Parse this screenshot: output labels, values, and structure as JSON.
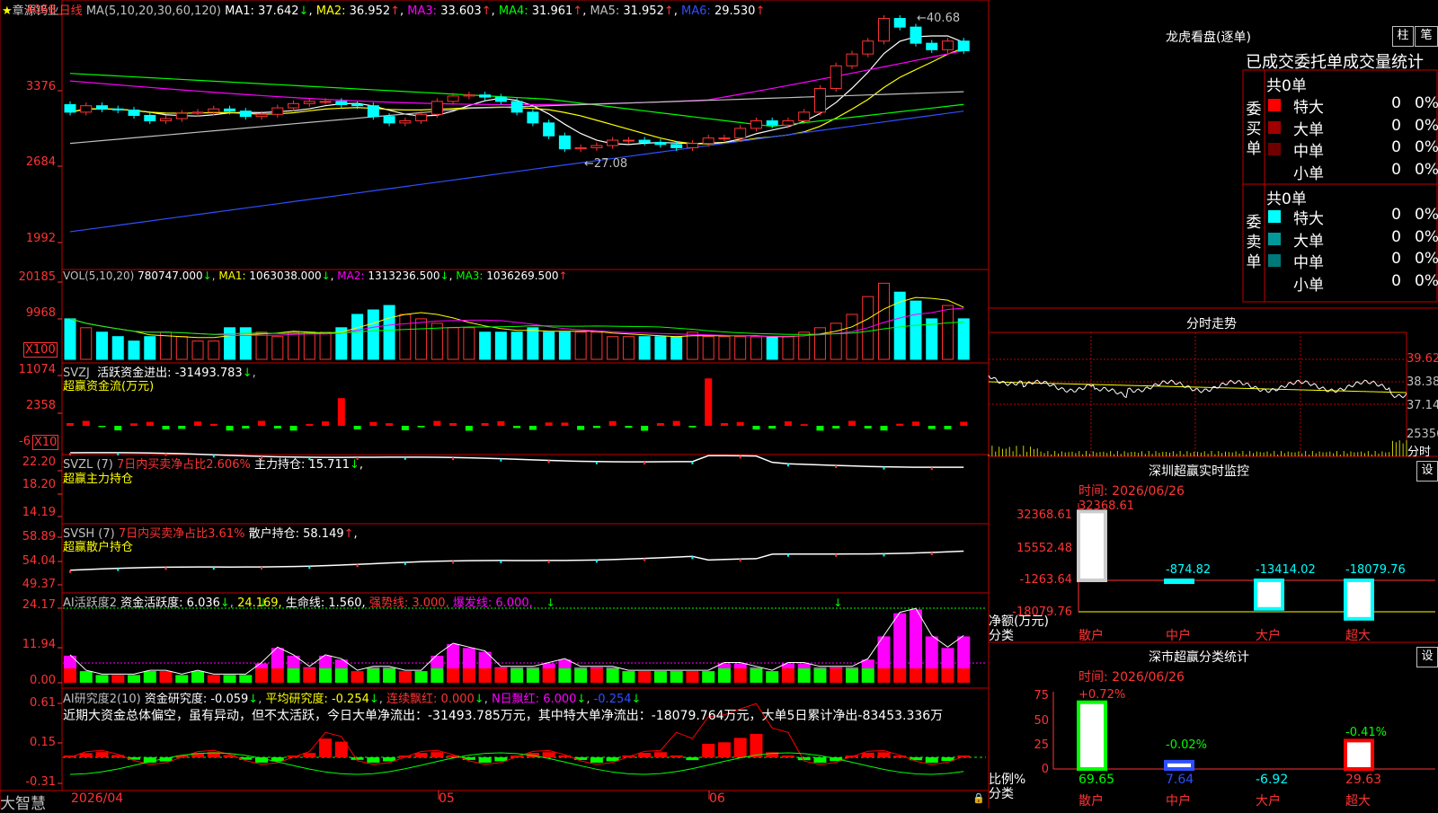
{
  "stock": {
    "name": "章源钨业",
    "period": "日线",
    "brand": "大智慧"
  },
  "kline": {
    "ma_header": "MA(5,10,20,30,60,120)",
    "ma": [
      {
        "label": "MA1:",
        "value": "37.642",
        "arrow": "↓",
        "color": "#ffffff"
      },
      {
        "label": "MA2:",
        "value": "36.952",
        "arrow": "↑",
        "color": "#ffff00"
      },
      {
        "label": "MA3:",
        "value": "33.603",
        "arrow": "↑",
        "color": "#ff00ff"
      },
      {
        "label": "MA4:",
        "value": "31.961",
        "arrow": "↑",
        "color": "#00ff00"
      },
      {
        "label": "MA5:",
        "value": "31.952",
        "arrow": "↑",
        "color": "#c0c0c0"
      },
      {
        "label": "MA6:",
        "value": "29.530",
        "arrow": "↑",
        "color": "#2f4fff"
      }
    ],
    "y_ticks": [
      "4068",
      "3376",
      "2684",
      "1992"
    ],
    "high_mark": "←40.68",
    "low_mark": "←27.08"
  },
  "volume": {
    "header": "VOL(5,10,20)",
    "value": "780747.000",
    "arrow": "↓",
    "ma": [
      {
        "label": "MA1:",
        "value": "1063038.000",
        "arrow": "↓",
        "color": "#ffff00"
      },
      {
        "label": "MA2:",
        "value": "1313236.500",
        "arrow": "↓",
        "color": "#ff00ff"
      },
      {
        "label": "MA3:",
        "value": "1036269.500",
        "arrow": "↑",
        "color": "#00ff00"
      }
    ],
    "y_ticks": [
      "20185",
      "9968"
    ],
    "unit": "X100"
  },
  "svzj": {
    "name": "SVZJ",
    "label": "活跃资金进出:",
    "value": "-31493.783",
    "arrow": "↓",
    "subtitle": "超赢资金流(万元)",
    "y_ticks": [
      "11074",
      "2358",
      "-6"
    ],
    "unit": "X10"
  },
  "svzl": {
    "name": "SVZL (7)",
    "note": "7日内买卖净占比2.606%",
    "label": "主力持仓:",
    "value": "15.711",
    "arrow": "↓",
    "trail": ",",
    "subtitle": "超赢主力持仓",
    "y_ticks": [
      "22.20",
      "18.20",
      "14.19"
    ]
  },
  "svsh": {
    "name": "SVSH (7)",
    "note": "7日内买卖净占比3.61%",
    "label": "散户持仓:",
    "value": "58.149",
    "arrow": "↑",
    "trail": ",",
    "subtitle": "超赢散户持仓",
    "y_ticks": [
      "58.89",
      "54.04",
      "49.37"
    ]
  },
  "ai_active": {
    "name": "AI活跃度2",
    "label": "资金活跃度:",
    "value": "6.036",
    "arrow": "↓",
    "v2": "24.169,",
    "life": "生命线: 1.560,",
    "strong": "强势线: 3.000,",
    "burst": "爆发线: 6.000,",
    "y_ticks": [
      "24.17",
      "11.94",
      "0.00"
    ]
  },
  "ai_research": {
    "name": "AI研究度2(10)",
    "label": "资金研究度:",
    "value": "-0.059",
    "arrow": "↓",
    "avg": "平均研究度: -0.254",
    "avg_arrow": "↓",
    "cont": "连续飘红: 0.000",
    "cont_arrow": "↓",
    "nday": "N日飘红: 6.000",
    "nday_arrow": "↓",
    "last": "-0.254",
    "last_arrow": "↓",
    "summary": "近期大资金总体偏空，虽有异动，但不太活跃，今日大单净流出：-31493.785万元，其中特大单净流出：-18079.764万元，大单5日累计净出-83453.336万",
    "y_ticks": [
      "0.61",
      "0.15",
      "-0.31"
    ]
  },
  "x_axis": {
    "labels": [
      "2026/04",
      "05",
      "06"
    ]
  },
  "longhu": {
    "title": "龙虎看盘(逐单)",
    "btn1": "柱",
    "btn2": "笔",
    "subtitle": "已成交委托单成交量统计",
    "buy": {
      "side": "委买单",
      "total": "共0单",
      "rows": [
        {
          "name": "特大",
          "val": "0",
          "pct": "0%",
          "color": "#ff0000"
        },
        {
          "name": "大单",
          "val": "0",
          "pct": "0%",
          "color": "#a00000"
        },
        {
          "name": "中单",
          "val": "0",
          "pct": "0%",
          "color": "#700000"
        },
        {
          "name": "小单",
          "val": "0",
          "pct": "0%",
          "color": "#000000"
        }
      ]
    },
    "sell": {
      "side": "委卖单",
      "total": "共0单",
      "rows": [
        {
          "name": "特大",
          "val": "0",
          "pct": "0%",
          "color": "#00ffff"
        },
        {
          "name": "大单",
          "val": "0",
          "pct": "0%",
          "color": "#009a9a"
        },
        {
          "name": "中单",
          "val": "0",
          "pct": "0%",
          "color": "#007878"
        },
        {
          "name": "小单",
          "val": "0",
          "pct": "0%",
          "color": "#000000"
        }
      ]
    }
  },
  "fenshi": {
    "title": "分时走势",
    "y_ticks": [
      "39.62",
      "38.38",
      "37.14",
      "25356"
    ],
    "footer": "分时"
  },
  "sz_monitor": {
    "title": "深圳超赢实时监控",
    "btn": "设",
    "time": "时间: 2026/06/26",
    "y_ticks": [
      "32368.61",
      "15552.48",
      "-1263.64",
      "-18079.76"
    ],
    "axis_label1": "净额(万元)",
    "axis_label2": "分类",
    "cats": [
      "散户",
      "中户",
      "大户",
      "超大"
    ],
    "values": [
      32368.61,
      -874.82,
      -13414.02,
      -18079.76
    ],
    "val_labels": [
      "32368.61",
      "-874.82",
      "-13414.02",
      "-18079.76"
    ]
  },
  "sz_class": {
    "title": "深市超赢分类统计",
    "btn": "设",
    "time": "时间: 2026/06/26",
    "y_ticks": [
      "75",
      "50",
      "25",
      "0"
    ],
    "axis_label1": "比例%",
    "axis_label2": "分类",
    "cats": [
      "散户",
      "中户",
      "大户",
      "超大"
    ],
    "top_labels": [
      "+0.72%",
      "-0.02%",
      "",
      "-0.41%"
    ],
    "bottom_labels": [
      "69.65",
      "7.64",
      "-6.92",
      "29.63"
    ],
    "values": [
      69.65,
      7.64,
      -6.92,
      29.63
    ]
  }
}
